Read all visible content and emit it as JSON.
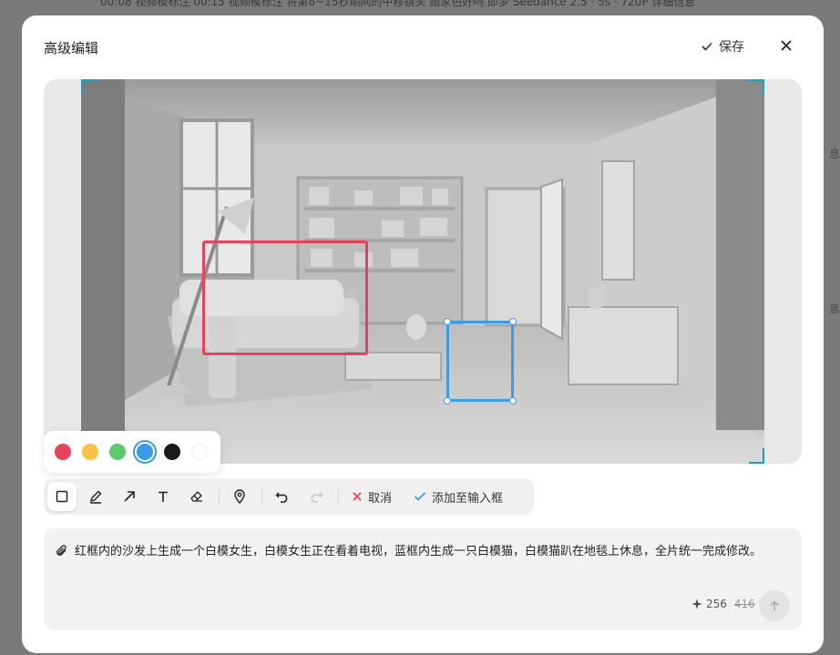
{
  "backdrop": {
    "topbar_text": "00:08 视频模标注 00:15 视频模标注 将第8~15秒期间的中移镜头 画家色好吗 即梦 Seedance 2.5 · 5s · 720P 详细信息",
    "side_label_1": "息",
    "side_label_2": "息"
  },
  "modal": {
    "title": "高级编辑",
    "save_label": "保存"
  },
  "palette": {
    "colors": [
      "#e8415a",
      "#f7c242",
      "#5cc96b",
      "#3a9ce8",
      "#1a1a1a",
      "#ffffff"
    ],
    "selected_index": 3
  },
  "toolbar": {
    "tools": [
      "rectangle",
      "brush",
      "arrow",
      "text",
      "eraser",
      "pin"
    ],
    "active_tool": "rectangle",
    "cancel_label": "取消",
    "add_label": "添加至输入框"
  },
  "prompt": {
    "text": "红框内的沙发上生成一个白模女生，白模女生正在看着电视，蓝框内生成一只白模猫，白模猫趴在地毯上休息，全片统一完成修改。",
    "credits": "256",
    "credits_original": "416"
  },
  "accent_color": "#3a9ce8"
}
